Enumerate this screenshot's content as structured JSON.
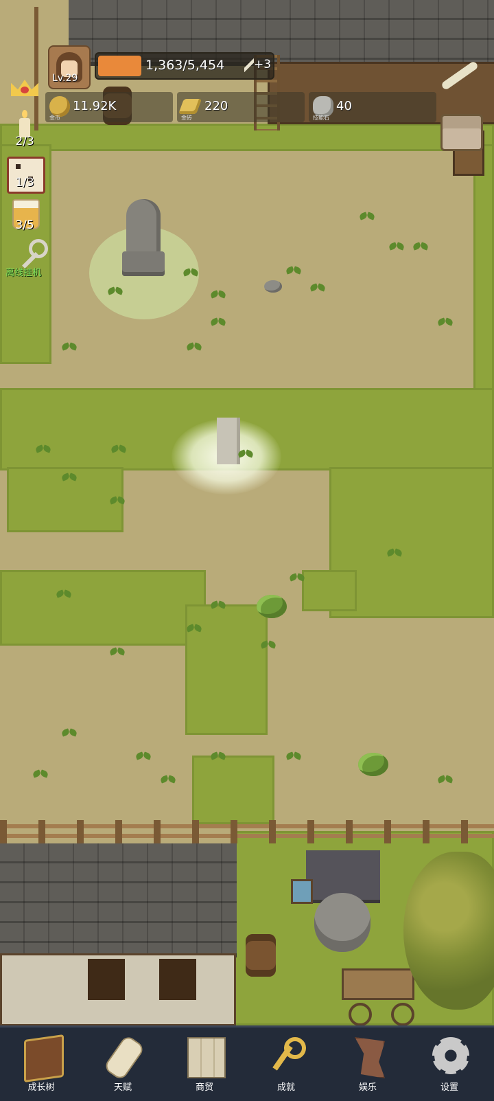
{
  "player": {
    "level": "Lv.29",
    "xp_text": "1,363/5,454",
    "xp_fraction": 0.25,
    "bonus": "+3"
  },
  "resources": [
    {
      "name": "gold-coin",
      "value": "11.92K",
      "caption": "金币",
      "color": "#d9b24a"
    },
    {
      "name": "gold-brick",
      "value": "220",
      "caption": "金砖",
      "color": "#e2c05a"
    },
    {
      "name": "skill-stone",
      "value": "40",
      "caption": "技能石",
      "color": "#b9b9b4"
    }
  ],
  "side": {
    "candle": "2/3",
    "dice": "1/3",
    "beer": "3/5",
    "idle_label": "离线挂机"
  },
  "nav": [
    {
      "label": "成长树",
      "icon": "book-icon"
    },
    {
      "label": "天赋",
      "icon": "scroll-icon"
    },
    {
      "label": "商贸",
      "icon": "map-icon"
    },
    {
      "label": "成就",
      "icon": "key-icon"
    },
    {
      "label": "娱乐",
      "icon": "banner-icon"
    },
    {
      "label": "设置",
      "icon": "gear-icon"
    }
  ],
  "colors": {
    "xp_fill": "#e9893a",
    "nav_bg": "#232b39",
    "idle_label": "#7ee05a"
  }
}
